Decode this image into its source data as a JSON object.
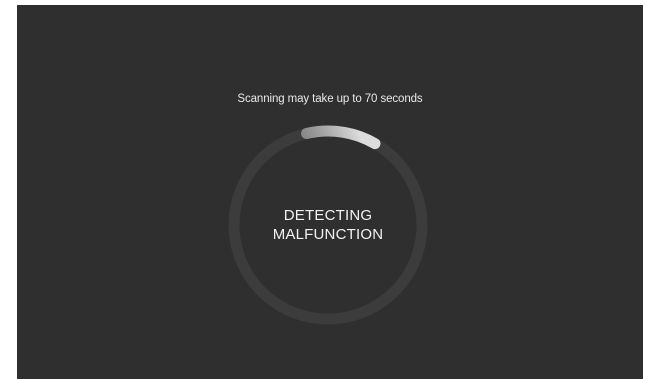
{
  "hint": {
    "text": "Scanning may take up to 70 seconds"
  },
  "status": {
    "line1": "DETECTING",
    "line2": "MALFUNCTION"
  },
  "progress": {
    "fraction": 0.12
  },
  "colors": {
    "background": "#2f2f2f",
    "track": "#3c3c3c",
    "progress_head": "#dcdcdc",
    "progress_tail": "#6e6e6e",
    "text": "#f2f2f2"
  }
}
